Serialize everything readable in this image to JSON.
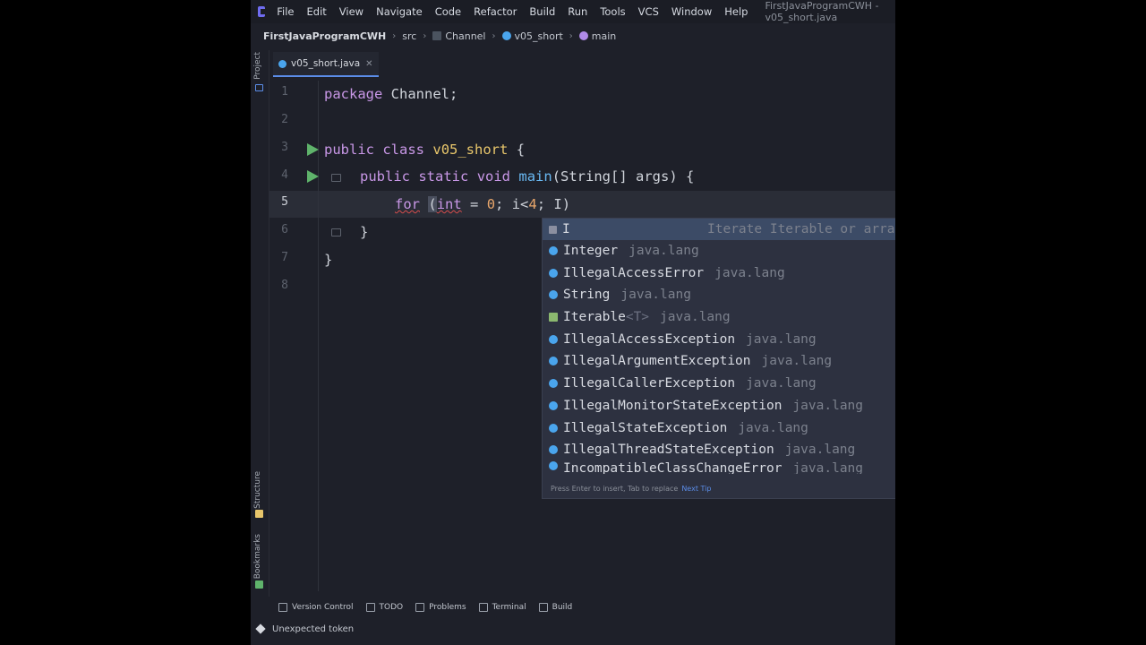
{
  "menubar": {
    "items": [
      "File",
      "Edit",
      "View",
      "Navigate",
      "Code",
      "Refactor",
      "Build",
      "Run",
      "Tools",
      "VCS",
      "Window",
      "Help"
    ],
    "window_title": "FirstJavaProgramCWH - v05_short.java"
  },
  "breadcrumbs": {
    "project": "FirstJavaProgramCWH",
    "items": [
      "src",
      "Channel",
      "v05_short",
      "main"
    ]
  },
  "left_strip": {
    "project": "Project",
    "structure": "Structure",
    "bookmarks": "Bookmarks"
  },
  "tab": {
    "label": "v05_short.java",
    "close": "✕"
  },
  "editor": {
    "line_numbers": [
      "1",
      "2",
      "3",
      "4",
      "5",
      "6",
      "7",
      "8"
    ],
    "current_line": "5",
    "lines": {
      "l1": {
        "kw": "package",
        "rest": " Channel;"
      },
      "l3": {
        "kw1": "public",
        "kw2": "class",
        "name": "v05_short",
        "rest": " {"
      },
      "l4": {
        "kw1": "public",
        "kw2": "static",
        "kw3": "void",
        "fn": "main",
        "rest": "(String[] args) {"
      },
      "l5": {
        "kw": "for",
        "sp": " ",
        "paren": "(",
        "p1": "int",
        "p2": " = ",
        "num": "0",
        "p3": "; i<",
        "num2": "4",
        "p4": "; I)"
      },
      "l6": {
        "text": "}"
      },
      "l7": {
        "text": "}"
      }
    }
  },
  "completion": {
    "items": [
      {
        "name": "I",
        "hint": "Iterate Iterable or array",
        "kind": "live"
      },
      {
        "name": "Integer",
        "package": "java.lang",
        "kind": "class"
      },
      {
        "name": "IllegalAccessError",
        "package": "java.lang",
        "kind": "class"
      },
      {
        "name": "String",
        "package": "java.lang",
        "kind": "class"
      },
      {
        "name": "Iterable",
        "generic": "<T>",
        "package": "java.lang",
        "kind": "interface"
      },
      {
        "name": "IllegalAccessException",
        "package": "java.lang",
        "kind": "class"
      },
      {
        "name": "IllegalArgumentException",
        "package": "java.lang",
        "kind": "class"
      },
      {
        "name": "IllegalCallerException",
        "package": "java.lang",
        "kind": "class"
      },
      {
        "name": "IllegalMonitorStateException",
        "package": "java.lang",
        "kind": "class"
      },
      {
        "name": "IllegalStateException",
        "package": "java.lang",
        "kind": "class"
      },
      {
        "name": "IllegalThreadStateException",
        "package": "java.lang",
        "kind": "class"
      },
      {
        "name": "IncompatibleClassChangeError",
        "package": "java.lang",
        "kind": "class"
      }
    ],
    "footer": "Press Enter to insert, Tab to replace",
    "footer_link": "Next Tip"
  },
  "bottom_tools": [
    "Version Control",
    "TODO",
    "Problems",
    "Terminal",
    "Build"
  ],
  "status": {
    "message": "Unexpected token"
  },
  "colors": {
    "accent": "#5b8de8",
    "run": "#5fb36b",
    "keyword": "#c897e6",
    "class_name": "#e8c66b",
    "function": "#69b8f2"
  }
}
